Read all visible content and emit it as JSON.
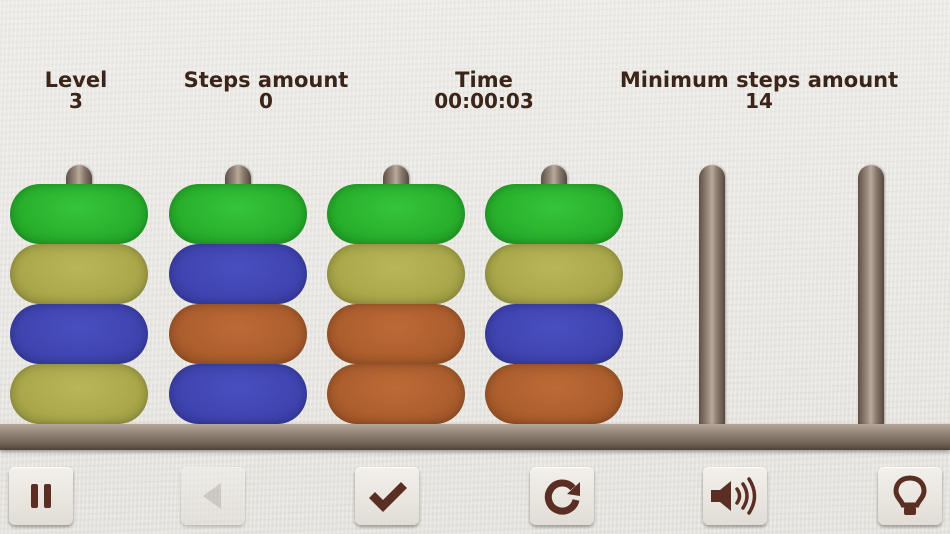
{
  "stats": {
    "level": {
      "label": "Level",
      "value": "3"
    },
    "steps": {
      "label": "Steps amount",
      "value": "0"
    },
    "time": {
      "label": "Time",
      "value": "00:00:03"
    },
    "min_steps": {
      "label": "Minimum steps amount",
      "value": "14"
    }
  },
  "pegs": [
    {
      "disks": [
        "green",
        "olive",
        "blue",
        "olive"
      ]
    },
    {
      "disks": [
        "green",
        "blue",
        "orange",
        "blue"
      ]
    },
    {
      "disks": [
        "green",
        "olive",
        "orange",
        "orange"
      ]
    },
    {
      "disks": [
        "green",
        "olive",
        "blue",
        "orange"
      ]
    },
    {
      "disks": []
    },
    {
      "disks": []
    }
  ],
  "colors": {
    "green": "#28b02c",
    "olive": "#aaa84a",
    "blue": "#3f44b1",
    "orange": "#ac5e2d",
    "text": "#3b2418",
    "icon": "#5a2e22"
  },
  "toolbar": [
    {
      "icon": "pause-icon",
      "enabled": true
    },
    {
      "icon": "undo-arrow-icon",
      "enabled": false
    },
    {
      "icon": "checkmark-icon",
      "enabled": true
    },
    {
      "icon": "restart-icon",
      "enabled": true
    },
    {
      "icon": "sound-on-icon",
      "enabled": true
    },
    {
      "icon": "lightbulb-hint-icon",
      "enabled": true
    }
  ]
}
